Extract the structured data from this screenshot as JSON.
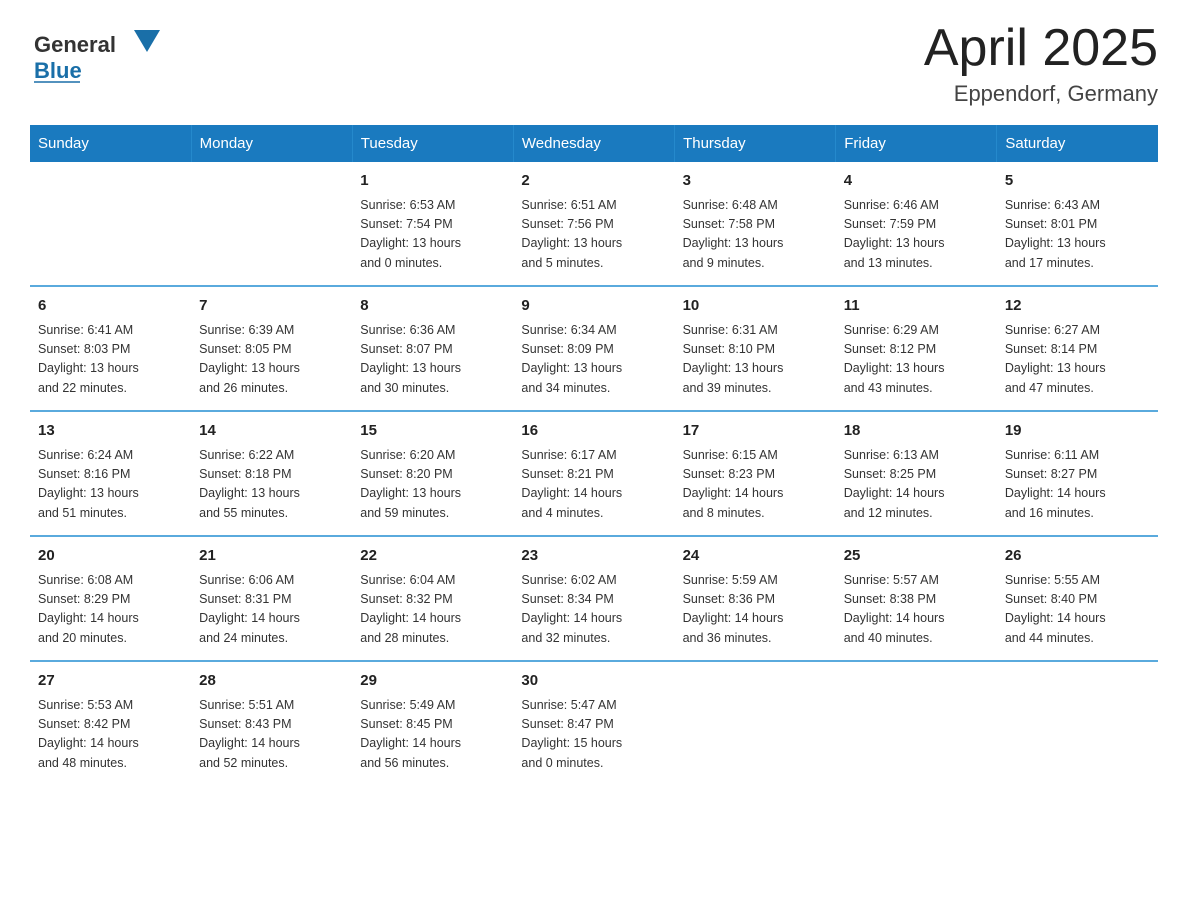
{
  "header": {
    "logo_general": "General",
    "logo_blue": "Blue",
    "title": "April 2025",
    "subtitle": "Eppendorf, Germany"
  },
  "days_of_week": [
    "Sunday",
    "Monday",
    "Tuesday",
    "Wednesday",
    "Thursday",
    "Friday",
    "Saturday"
  ],
  "weeks": [
    [
      {
        "day": "",
        "info": ""
      },
      {
        "day": "",
        "info": ""
      },
      {
        "day": "1",
        "info": "Sunrise: 6:53 AM\nSunset: 7:54 PM\nDaylight: 13 hours\nand 0 minutes."
      },
      {
        "day": "2",
        "info": "Sunrise: 6:51 AM\nSunset: 7:56 PM\nDaylight: 13 hours\nand 5 minutes."
      },
      {
        "day": "3",
        "info": "Sunrise: 6:48 AM\nSunset: 7:58 PM\nDaylight: 13 hours\nand 9 minutes."
      },
      {
        "day": "4",
        "info": "Sunrise: 6:46 AM\nSunset: 7:59 PM\nDaylight: 13 hours\nand 13 minutes."
      },
      {
        "day": "5",
        "info": "Sunrise: 6:43 AM\nSunset: 8:01 PM\nDaylight: 13 hours\nand 17 minutes."
      }
    ],
    [
      {
        "day": "6",
        "info": "Sunrise: 6:41 AM\nSunset: 8:03 PM\nDaylight: 13 hours\nand 22 minutes."
      },
      {
        "day": "7",
        "info": "Sunrise: 6:39 AM\nSunset: 8:05 PM\nDaylight: 13 hours\nand 26 minutes."
      },
      {
        "day": "8",
        "info": "Sunrise: 6:36 AM\nSunset: 8:07 PM\nDaylight: 13 hours\nand 30 minutes."
      },
      {
        "day": "9",
        "info": "Sunrise: 6:34 AM\nSunset: 8:09 PM\nDaylight: 13 hours\nand 34 minutes."
      },
      {
        "day": "10",
        "info": "Sunrise: 6:31 AM\nSunset: 8:10 PM\nDaylight: 13 hours\nand 39 minutes."
      },
      {
        "day": "11",
        "info": "Sunrise: 6:29 AM\nSunset: 8:12 PM\nDaylight: 13 hours\nand 43 minutes."
      },
      {
        "day": "12",
        "info": "Sunrise: 6:27 AM\nSunset: 8:14 PM\nDaylight: 13 hours\nand 47 minutes."
      }
    ],
    [
      {
        "day": "13",
        "info": "Sunrise: 6:24 AM\nSunset: 8:16 PM\nDaylight: 13 hours\nand 51 minutes."
      },
      {
        "day": "14",
        "info": "Sunrise: 6:22 AM\nSunset: 8:18 PM\nDaylight: 13 hours\nand 55 minutes."
      },
      {
        "day": "15",
        "info": "Sunrise: 6:20 AM\nSunset: 8:20 PM\nDaylight: 13 hours\nand 59 minutes."
      },
      {
        "day": "16",
        "info": "Sunrise: 6:17 AM\nSunset: 8:21 PM\nDaylight: 14 hours\nand 4 minutes."
      },
      {
        "day": "17",
        "info": "Sunrise: 6:15 AM\nSunset: 8:23 PM\nDaylight: 14 hours\nand 8 minutes."
      },
      {
        "day": "18",
        "info": "Sunrise: 6:13 AM\nSunset: 8:25 PM\nDaylight: 14 hours\nand 12 minutes."
      },
      {
        "day": "19",
        "info": "Sunrise: 6:11 AM\nSunset: 8:27 PM\nDaylight: 14 hours\nand 16 minutes."
      }
    ],
    [
      {
        "day": "20",
        "info": "Sunrise: 6:08 AM\nSunset: 8:29 PM\nDaylight: 14 hours\nand 20 minutes."
      },
      {
        "day": "21",
        "info": "Sunrise: 6:06 AM\nSunset: 8:31 PM\nDaylight: 14 hours\nand 24 minutes."
      },
      {
        "day": "22",
        "info": "Sunrise: 6:04 AM\nSunset: 8:32 PM\nDaylight: 14 hours\nand 28 minutes."
      },
      {
        "day": "23",
        "info": "Sunrise: 6:02 AM\nSunset: 8:34 PM\nDaylight: 14 hours\nand 32 minutes."
      },
      {
        "day": "24",
        "info": "Sunrise: 5:59 AM\nSunset: 8:36 PM\nDaylight: 14 hours\nand 36 minutes."
      },
      {
        "day": "25",
        "info": "Sunrise: 5:57 AM\nSunset: 8:38 PM\nDaylight: 14 hours\nand 40 minutes."
      },
      {
        "day": "26",
        "info": "Sunrise: 5:55 AM\nSunset: 8:40 PM\nDaylight: 14 hours\nand 44 minutes."
      }
    ],
    [
      {
        "day": "27",
        "info": "Sunrise: 5:53 AM\nSunset: 8:42 PM\nDaylight: 14 hours\nand 48 minutes."
      },
      {
        "day": "28",
        "info": "Sunrise: 5:51 AM\nSunset: 8:43 PM\nDaylight: 14 hours\nand 52 minutes."
      },
      {
        "day": "29",
        "info": "Sunrise: 5:49 AM\nSunset: 8:45 PM\nDaylight: 14 hours\nand 56 minutes."
      },
      {
        "day": "30",
        "info": "Sunrise: 5:47 AM\nSunset: 8:47 PM\nDaylight: 15 hours\nand 0 minutes."
      },
      {
        "day": "",
        "info": ""
      },
      {
        "day": "",
        "info": ""
      },
      {
        "day": "",
        "info": ""
      }
    ]
  ]
}
